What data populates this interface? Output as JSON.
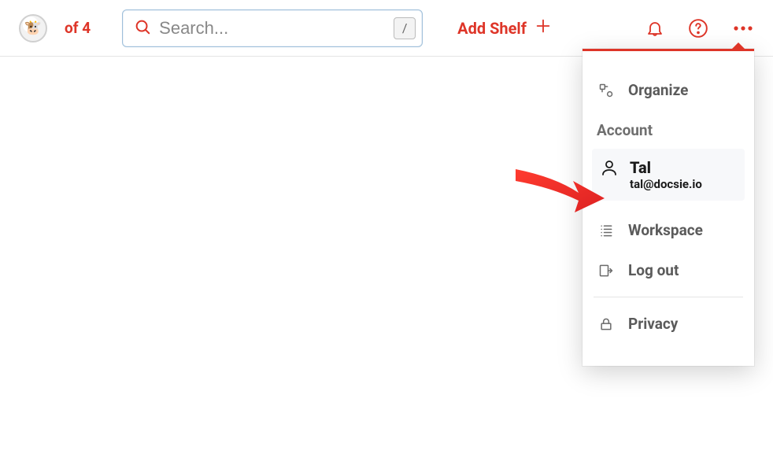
{
  "topbar": {
    "counter_text": "of 4",
    "search_placeholder": "Search...",
    "slash_hint": "/",
    "add_shelf_label": "Add Shelf"
  },
  "menu": {
    "organize_label": "Organize",
    "account_section_label": "Account",
    "account": {
      "name": "Tal",
      "email": "tal@docsie.io"
    },
    "workspace_label": "Workspace",
    "logout_label": "Log out",
    "privacy_label": "Privacy"
  }
}
